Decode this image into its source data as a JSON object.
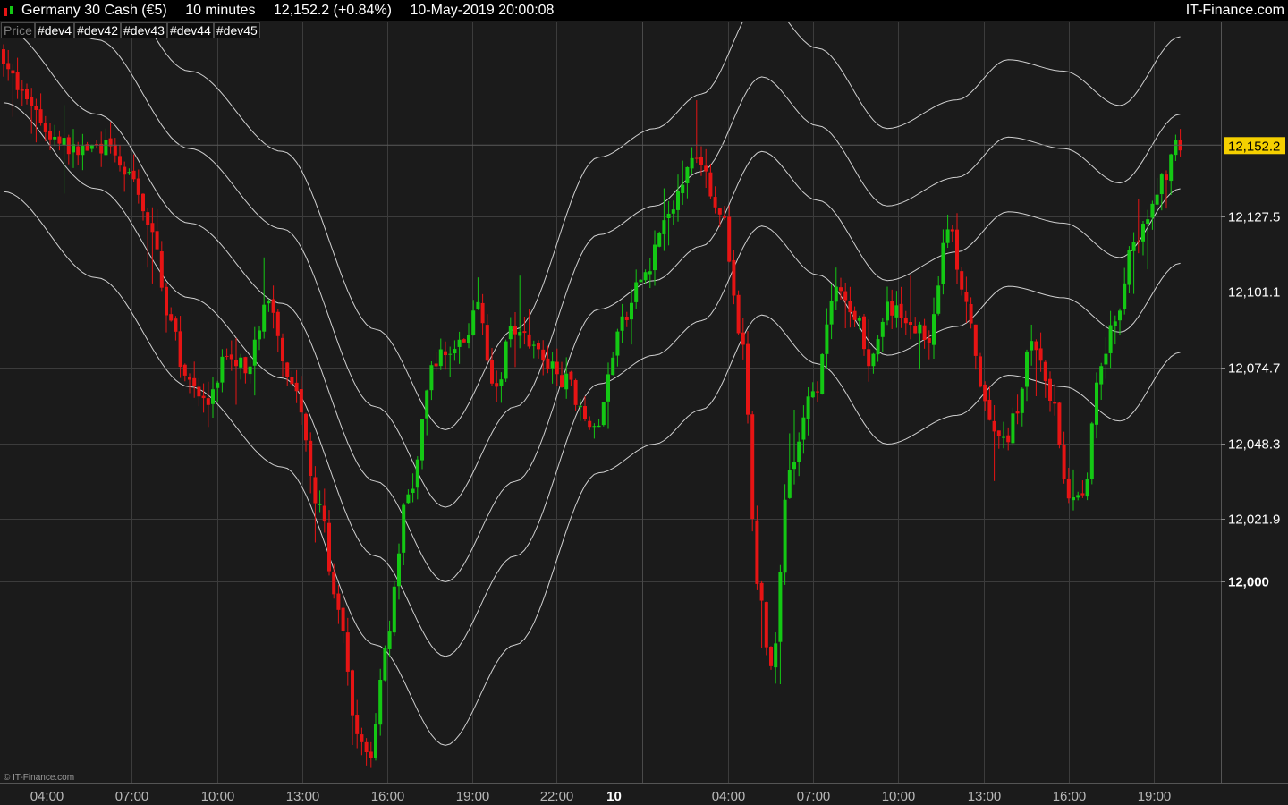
{
  "header": {
    "instrument": "Germany 30 Cash (€5)",
    "timeframe": "10 minutes",
    "price_change": "12,152.2 (+0.84%)",
    "datetime": "10-May-2019 20:00:08",
    "brand": "IT-Finance.com"
  },
  "legend": [
    "Price",
    "#dev4",
    "#dev42",
    "#dev43",
    "#dev44",
    "#dev45"
  ],
  "watermark": "© IT-Finance.com",
  "colors": {
    "background": "#1b1b1b",
    "up": "#14c814",
    "down": "#e61414",
    "band": "#d0d0d0",
    "grid": "#3c3c3c",
    "last_price_bg": "#f5d000"
  },
  "chart_data": {
    "type": "candlestick",
    "ylim": [
      11930,
      12195
    ],
    "y_ticks": [
      {
        "value": 12000,
        "label": "12,000",
        "bold": true
      },
      {
        "value": 12021.9,
        "label": "12,021.9"
      },
      {
        "value": 12048.3,
        "label": "12,048.3"
      },
      {
        "value": 12074.7,
        "label": "12,074.7"
      },
      {
        "value": 12101.1,
        "label": "12,101.1"
      },
      {
        "value": 12127.5,
        "label": "12,127.5"
      }
    ],
    "last_price": {
      "value": 12152.2,
      "label": "12,152.2"
    },
    "x_ticks": [
      "04:00",
      "07:00",
      "10:00",
      "13:00",
      "16:00",
      "19:00",
      "22:00",
      "10",
      "04:00",
      "07:00",
      "10:00",
      "13:00",
      "16:00",
      "19:00"
    ],
    "x_tick_bold": [
      false,
      false,
      false,
      false,
      false,
      false,
      false,
      true,
      false,
      false,
      false,
      false,
      false,
      false
    ],
    "anchors": [
      [
        0,
        12185
      ],
      [
        5,
        12170
      ],
      [
        12,
        12155
      ],
      [
        16,
        12150
      ],
      [
        22,
        12152
      ],
      [
        29,
        12140
      ],
      [
        33,
        12120
      ],
      [
        37,
        12090
      ],
      [
        40,
        12072
      ],
      [
        45,
        12062
      ],
      [
        49,
        12080
      ],
      [
        53,
        12075
      ],
      [
        58,
        12097
      ],
      [
        63,
        12070
      ],
      [
        69,
        12025
      ],
      [
        73,
        11988
      ],
      [
        77,
        11945
      ],
      [
        80,
        11940
      ],
      [
        83,
        11978
      ],
      [
        88,
        12030
      ],
      [
        94,
        12078
      ],
      [
        99,
        12082
      ],
      [
        103,
        12095
      ],
      [
        107,
        12065
      ],
      [
        110,
        12090
      ],
      [
        114,
        12085
      ],
      [
        118,
        12075
      ],
      [
        122,
        12070
      ],
      [
        125,
        12062
      ],
      [
        128,
        12052
      ],
      [
        134,
        12090
      ],
      [
        139,
        12108
      ],
      [
        143,
        12125
      ],
      [
        150,
        12150
      ],
      [
        155,
        12130
      ],
      [
        160,
        12080
      ],
      [
        163,
        12000
      ],
      [
        166,
        11970
      ],
      [
        170,
        12040
      ],
      [
        175,
        12065
      ],
      [
        180,
        12100
      ],
      [
        185,
        12092
      ],
      [
        187,
        12075
      ],
      [
        191,
        12095
      ],
      [
        195,
        12092
      ],
      [
        200,
        12085
      ],
      [
        204,
        12125
      ],
      [
        208,
        12095
      ],
      [
        212,
        12060
      ],
      [
        216,
        12048
      ],
      [
        219,
        12060
      ],
      [
        222,
        12085
      ],
      [
        226,
        12065
      ],
      [
        230,
        12028
      ],
      [
        233,
        12030
      ],
      [
        237,
        12078
      ],
      [
        240,
        12092
      ],
      [
        244,
        12120
      ],
      [
        247,
        12125
      ],
      [
        250,
        12140
      ],
      [
        253,
        12152
      ]
    ],
    "band_anchors": [
      [
        0,
        12188
      ],
      [
        20,
        12158
      ],
      [
        40,
        12120
      ],
      [
        60,
        12092
      ],
      [
        80,
        12030
      ],
      [
        95,
        11995
      ],
      [
        110,
        12030
      ],
      [
        128,
        12090
      ],
      [
        140,
        12100
      ],
      [
        150,
        12112
      ],
      [
        163,
        12145
      ],
      [
        175,
        12128
      ],
      [
        190,
        12100
      ],
      [
        205,
        12110
      ],
      [
        216,
        12124
      ],
      [
        228,
        12120
      ],
      [
        240,
        12108
      ],
      [
        253,
        12132
      ]
    ],
    "band_offsets": [
      58,
      31,
      5,
      -21,
      -52
    ],
    "series": [
      {
        "name": "#dev4",
        "offset": 58
      },
      {
        "name": "#dev42",
        "offset": 31
      },
      {
        "name": "#dev43",
        "offset": 5
      },
      {
        "name": "#dev44",
        "offset": -21
      },
      {
        "name": "#dev45",
        "offset": -52
      }
    ]
  }
}
